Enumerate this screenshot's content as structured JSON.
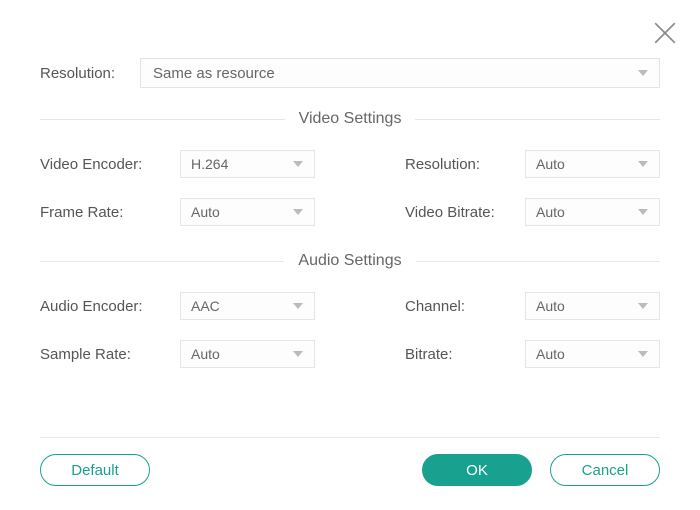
{
  "top": {
    "resolution_label": "Resolution:",
    "resolution_value": "Same as resource"
  },
  "sections": {
    "video_title": "Video Settings",
    "audio_title": "Audio Settings"
  },
  "video": {
    "encoder_label": "Video Encoder:",
    "encoder_value": "H.264",
    "resolution_label": "Resolution:",
    "resolution_value": "Auto",
    "framerate_label": "Frame Rate:",
    "framerate_value": "Auto",
    "bitrate_label": "Video Bitrate:",
    "bitrate_value": "Auto"
  },
  "audio": {
    "encoder_label": "Audio Encoder:",
    "encoder_value": "AAC",
    "channel_label": "Channel:",
    "channel_value": "Auto",
    "samplerate_label": "Sample Rate:",
    "samplerate_value": "Auto",
    "bitrate_label": "Bitrate:",
    "bitrate_value": "Auto"
  },
  "buttons": {
    "default": "Default",
    "ok": "OK",
    "cancel": "Cancel"
  },
  "colors": {
    "accent": "#18a18f"
  }
}
